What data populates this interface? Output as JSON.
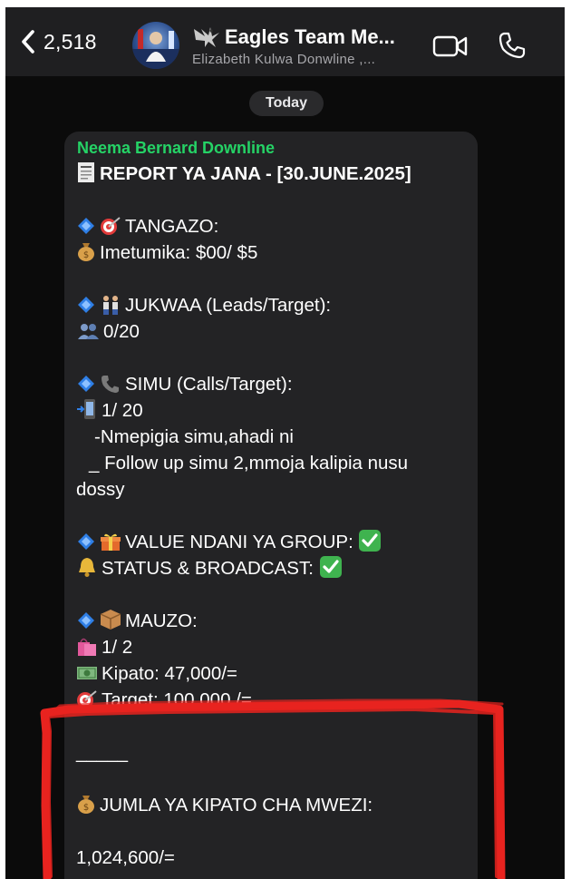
{
  "header": {
    "back_count": "2,518",
    "group_title": "Eagles Team Me...",
    "group_subtitle": "Elizabeth Kulwa Donwline ,...",
    "icons": [
      "chevron-left-icon",
      "group-avatar",
      "eagle-icon",
      "video-call-icon",
      "phone-icon"
    ]
  },
  "date_separator": "Today",
  "message": {
    "sender": "Neema Bernard Downline",
    "lines": [
      "REPORT YA JANA - [30.JUNE.2025]",
      "TANGAZO:",
      "Imetumika: $00/ $5",
      "JUKWAA (Leads/Target):",
      "0/20",
      "SIMU (Calls/Target):",
      "1/ 20",
      "-Nmepigia simu,ahadi ni",
      "_ Follow up simu 2,mmoja kalipia nusu",
      "dossy",
      "VALUE NDANI YA GROUP:",
      "STATUS & BROADCAST:",
      "MAUZO:",
      "1/ 2",
      "Kipato: 47,000/=",
      "Target: 100,000 /=",
      "_____",
      "JUMLA YA KIPATO CHA MWEZI:",
      "1,024,600/="
    ]
  },
  "annotation": {
    "color": "#e8231f"
  }
}
